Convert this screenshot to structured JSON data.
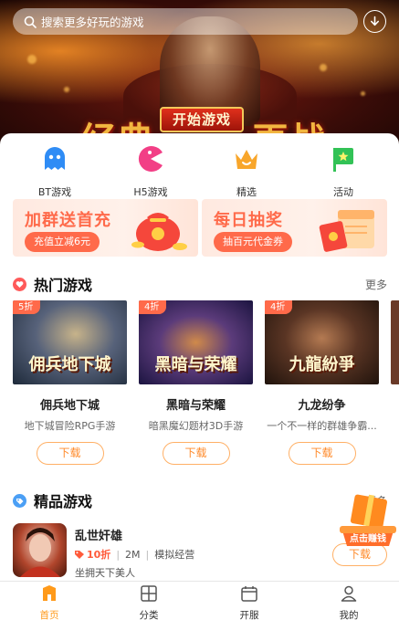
{
  "search": {
    "placeholder": "搜索更多好玩的游戏"
  },
  "banner": {
    "left_text": "经典",
    "right_text": "再战",
    "start_label": "开始游戏"
  },
  "categories": [
    {
      "label": "BT游戏",
      "icon": "ghost-icon",
      "color": "#2f8cf5"
    },
    {
      "label": "H5游戏",
      "icon": "pacman-icon",
      "color": "#f23f86"
    },
    {
      "label": "精选",
      "icon": "crown-icon",
      "color": "#f8a62b"
    },
    {
      "label": "活动",
      "icon": "flag-star-icon",
      "color": "#32c256"
    }
  ],
  "promos": [
    {
      "title": "加群送首充",
      "button": "充值立减6元"
    },
    {
      "title": "每日抽奖",
      "button": "抽百元代金券"
    }
  ],
  "hot_games": {
    "title": "热门游戏",
    "more": "更多",
    "items": [
      {
        "discount": "5折",
        "name": "佣兵地下城",
        "desc": "地下城冒险RPG手游",
        "button": "下载",
        "art": "佣兵地下城"
      },
      {
        "discount": "4折",
        "name": "黑暗与荣耀",
        "desc": "暗黑魔幻题材3D手游",
        "button": "下载",
        "art": "黑暗与荣耀"
      },
      {
        "discount": "4折",
        "name": "九龙纷争",
        "desc": "一个不一样的群雄争霸...",
        "button": "下载",
        "art": "九龍紛爭"
      }
    ]
  },
  "boutique": {
    "title": "精品游戏",
    "more": "更多",
    "item": {
      "name": "乱世奸雄",
      "discount": "10折",
      "size": "2M",
      "genre": "模拟经营",
      "tagline": "坐拥天下美人",
      "button": "下载"
    }
  },
  "float_badge": {
    "label": "点击赚钱"
  },
  "nav": [
    {
      "label": "首页",
      "icon": "home-icon",
      "active": true
    },
    {
      "label": "分类",
      "icon": "grid-icon",
      "active": false
    },
    {
      "label": "开服",
      "icon": "calendar-icon",
      "active": false
    },
    {
      "label": "我的",
      "icon": "user-icon",
      "active": false
    }
  ],
  "colors": {
    "accent": "#ff9a1a",
    "discount": "#ff6a4a",
    "button_border": "#ffb066"
  }
}
